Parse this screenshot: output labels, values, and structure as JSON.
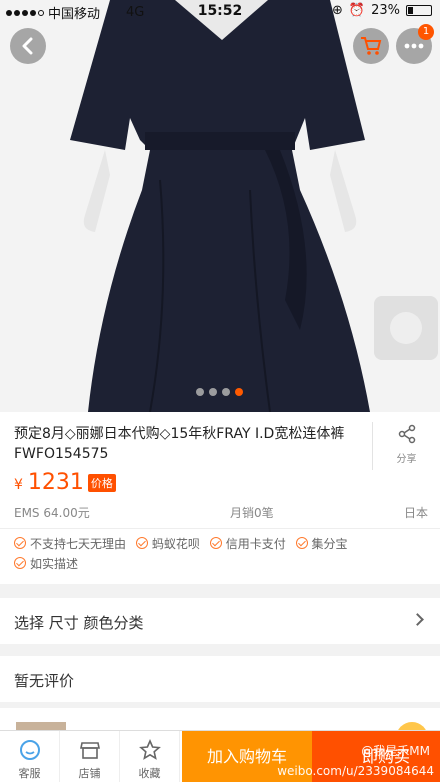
{
  "status_bar": {
    "carrier": "中国移动",
    "network": "4G",
    "time": "15:52",
    "battery": "23%",
    "battery_level": 0.23
  },
  "header": {
    "cart_badge_count": "1",
    "back_icon": "chevron-left-icon",
    "cart_icon": "cart-icon",
    "more_icon": "more-dots-icon"
  },
  "gallery": {
    "slide_count": 4,
    "active_index": 3
  },
  "product": {
    "title": "预定8月◇丽娜日本代购◇15年秋FRAY I.D宽松连体裤FWFO154575",
    "share_label": "分享",
    "price_symbol": "¥",
    "price": "1231",
    "price_tag": "价格",
    "shipping": "EMS 64.00元",
    "monthly_sales": "月销0笔",
    "origin": "日本"
  },
  "services": [
    "不支持七天无理由",
    "蚂蚁花呗",
    "信用卡支付",
    "集分宝",
    "如实描述"
  ],
  "options_row": {
    "label": "选择 尺寸 颜色分类"
  },
  "reviews_row": {
    "label": "暂无评价"
  },
  "bottom_bar": {
    "tabs": [
      {
        "label": "客服",
        "icon": "customer-service-icon"
      },
      {
        "label": "店铺",
        "icon": "shop-icon"
      },
      {
        "label": "收藏",
        "icon": "star-icon"
      }
    ],
    "add_to_cart": "加入购物车",
    "buy_now": "即购买"
  },
  "watermark": {
    "line1": "@我是禾MM",
    "line2": "weibo.com/u/2339084644"
  },
  "colors": {
    "accent": "#ff5000",
    "cart_button": "#ff9402"
  }
}
